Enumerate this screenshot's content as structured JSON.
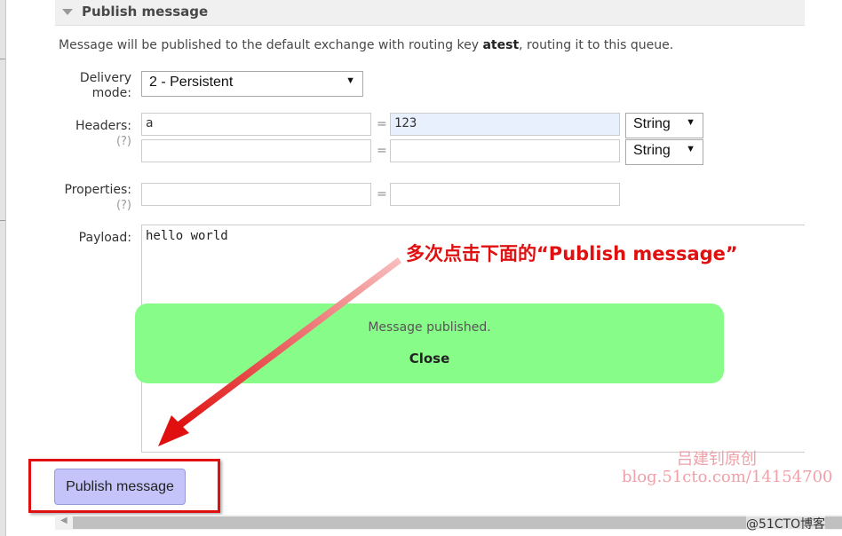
{
  "section": {
    "title": "Publish message",
    "description_pre": "Message will be published to the default exchange with routing key ",
    "routing_key": "atest",
    "description_post": ", routing it to this queue."
  },
  "form": {
    "delivery_label_1": "Delivery",
    "delivery_label_2": "mode:",
    "delivery_value": "2 - Persistent",
    "headers_label": "Headers:",
    "help": "(?)",
    "headers": [
      {
        "key": "a",
        "value": "123",
        "type": "String"
      },
      {
        "key": "",
        "value": "",
        "type": "String"
      }
    ],
    "properties_label": "Properties:",
    "properties": [
      {
        "key": "",
        "value": ""
      }
    ],
    "payload_label": "Payload:",
    "payload": "hello world",
    "eq": "="
  },
  "popup": {
    "message": "Message published.",
    "close": "Close",
    "color": "#88fc88"
  },
  "publish_button": "Publish message",
  "annotation": "多次点击下面的“Publish message”",
  "watermark": {
    "line1": "吕建钊原创",
    "line2": "blog.51cto.com/14154700",
    "corner": "@51CTO博客"
  }
}
